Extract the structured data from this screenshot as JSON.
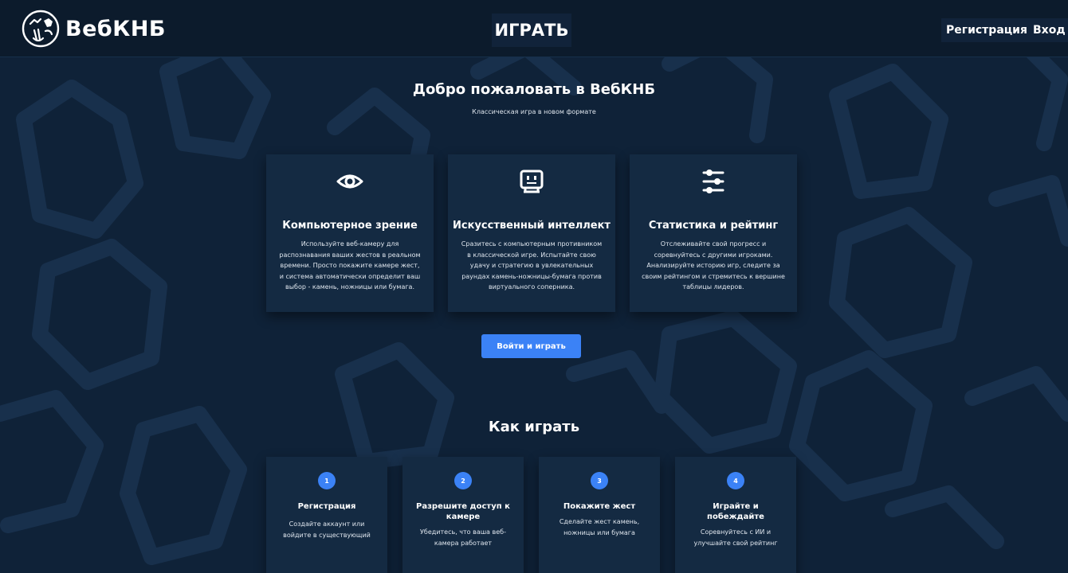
{
  "header": {
    "logo_text": "ВебКНБ",
    "play_label": "ИГРАТЬ",
    "register_label": "Регистрация",
    "login_label": "Вход"
  },
  "hero": {
    "title": "Добро пожаловать в ВебКНБ",
    "subtitle": "Классическая игра в новом формате"
  },
  "features": [
    {
      "icon": "eye-icon",
      "title": "Компьютерное зрение",
      "text": "Используйте веб-камеру для распознавания ваших жестов в реальном времени. Просто покажите камере жест, и система автоматически определит ваш выбор - камень, ножницы или бумага."
    },
    {
      "icon": "robot-icon",
      "title": "Искусственный интеллект",
      "text": "Сразитесь с компьютерным противником в классической игре. Испытайте свою удачу и стратегию в увлекательных раундах камень-ножницы-бумага против виртуального соперника."
    },
    {
      "icon": "sliders-icon",
      "title": "Статистика и рейтинг",
      "text": "Отслеживайте свой прогресс и соревнуйтесь с другими игроками. Анализируйте историю игр, следите за своим рейтингом и стремитесь к вершине таблицы лидеров."
    }
  ],
  "cta": {
    "label": "Войти и играть"
  },
  "how_to_play": {
    "title": "Как играть",
    "steps": [
      {
        "number": "1",
        "title": "Регистрация",
        "text": "Создайте аккаунт или войдите в существующий"
      },
      {
        "number": "2",
        "title": "Разрешите доступ к камере",
        "text": "Убедитесь, что ваша веб-камера работает"
      },
      {
        "number": "3",
        "title": "Покажите жест",
        "text": "Сделайте жест камень, ножницы или бумага"
      },
      {
        "number": "4",
        "title": "Играйте и побеждайте",
        "text": "Соревнуйтесь с ИИ и улучшайте свой рейтинг"
      }
    ]
  },
  "colors": {
    "background": "#0f2238",
    "header": "#0c1b2c",
    "card": "#142a42",
    "accent": "#3b82f6",
    "text": "#ffffff"
  }
}
